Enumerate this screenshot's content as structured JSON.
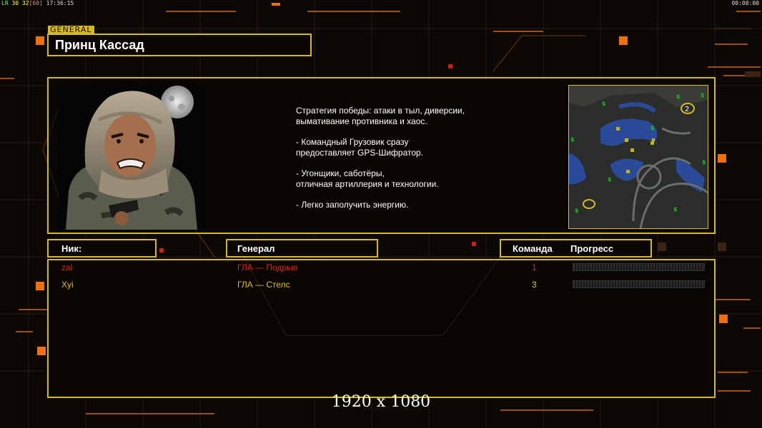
{
  "hud": {
    "fps_label": "LR",
    "fps": "30",
    "frame": "32",
    "frame_cap": "[60]",
    "clock": "17:36:15",
    "timer": "00:00:00"
  },
  "general": {
    "tag": "GENERAL",
    "name": "Принц Кассад",
    "description": [
      "Стратегия победы: атаки в тыл, диверсии,\n вымативание противника и хаос.",
      "- Командный Грузовик сразу\nпредоставляет GPS-Шифратор.",
      "- Угонщики, саботёры,\nотличная артиллерия и технологии.",
      "- Легко заполучить энергию."
    ]
  },
  "minimap": {
    "player_slot": "2"
  },
  "table": {
    "headers": {
      "nick": "Ник:",
      "general": "Генерал",
      "team": "Команда",
      "progress": "Прогресс"
    },
    "rows": [
      {
        "nick": "zal",
        "general": "ГЛА — Подрыв",
        "team": "1",
        "color": "#e8201a",
        "progress": 0
      },
      {
        "nick": "Xyi",
        "general": "ГЛА — Стелс",
        "team": "3",
        "color": "#e0c21c",
        "progress": 0
      }
    ]
  },
  "resolution": "1920 x 1080",
  "colors": {
    "accent": "#d7b923",
    "orange": "#f07010"
  }
}
